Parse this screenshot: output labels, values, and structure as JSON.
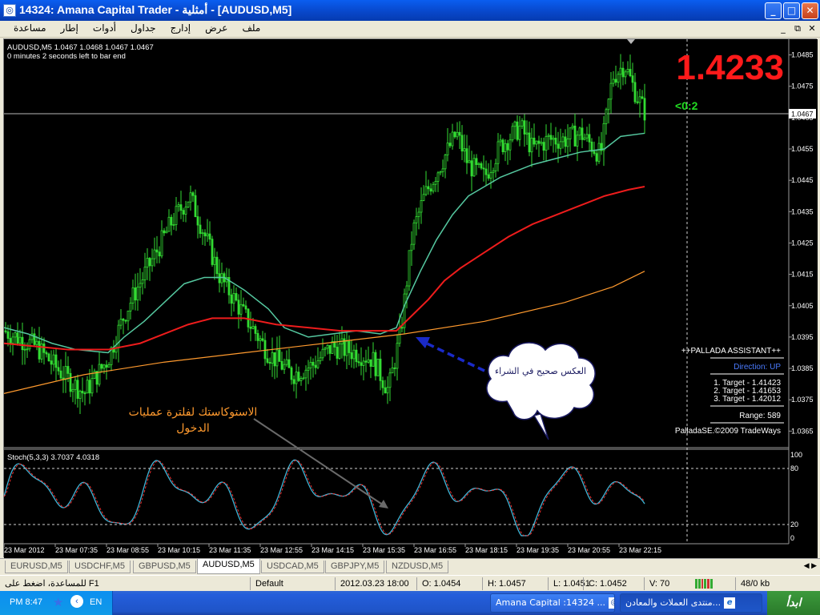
{
  "window": {
    "title": "14324: Amana Capital Trader - أمثلية - [AUDUSD,M5]",
    "app_icon": "amana-logo-icon",
    "buttons": {
      "minimize": "_",
      "maximize": "□",
      "close": "✕"
    }
  },
  "menu": {
    "items": [
      "ملف",
      "عرض",
      "إدارج",
      "جداول",
      "أدوات",
      "إطار",
      "مساعدة"
    ],
    "mdi_buttons": {
      "minimize": "_",
      "restore": "⧉",
      "close": "✕"
    }
  },
  "chart": {
    "symbol_header": "AUDUSD,M5  1.0467 1.0468 1.0467 1.0467",
    "bar_timer": "0 minutes 2 seconds left to bar end",
    "big_price": "1.4233",
    "spread_label": "<0:2",
    "current_price_tag": "1.0467",
    "price_axis": [
      "1.0485",
      "1.0475",
      "1.0465",
      "1.0455",
      "1.0445",
      "1.0435",
      "1.0425",
      "1.0415",
      "1.0405",
      "1.0395",
      "1.0385",
      "1.0375",
      "1.0365"
    ],
    "annotations": {
      "stochastic_note_line1": "الاستوكاستك لفلترة عمليات",
      "stochastic_note_line2": "الدخول",
      "cloud_text": "العكس صحيح في الشراء"
    },
    "panel": {
      "title": "++PALLADA ASSISTANT++",
      "direction": "Direction: UP",
      "target1": "1. Target - 1.41423",
      "target2": "2. Target - 1.41653",
      "target3": "3. Target - 1.42012",
      "range": "Range: 589",
      "copyright": "PalladaSE.©2009 TradeWays"
    },
    "stoch": {
      "label": "Stoch(5,3,3) 3.7037 4.0318",
      "levels": [
        "100",
        "80",
        "20",
        "0"
      ]
    },
    "time_axis": [
      "23 Mar 2012",
      "23 Mar 07:35",
      "23 Mar 08:55",
      "23 Mar 10:15",
      "23 Mar 11:35",
      "23 Mar 12:55",
      "23 Mar 14:15",
      "23 Mar 15:35",
      "23 Mar 16:55",
      "23 Mar 18:15",
      "23 Mar 19:35",
      "23 Mar 20:55",
      "23 Mar 22:15"
    ],
    "colors": {
      "candles": "#33dd33",
      "fast_ma": "#55c8a0",
      "slow_ma": "#ee1c1c",
      "long_ma": "#ff9a2e",
      "stoch_main": "#3fb6d8",
      "stoch_signal": "#ee3030",
      "big_price": "#ff1a1a",
      "spread": "#22dd22"
    }
  },
  "tabs": {
    "items": [
      "EURUSD,M5",
      "USDCHF,M5",
      "GBPUSD,M5",
      "AUDUSD,M5",
      "USDCAD,M5",
      "GBPJPY,M5",
      "NZDUSD,M5"
    ],
    "active": "AUDUSD,M5"
  },
  "status": {
    "help": "للمساعدة، اضغط على F1",
    "profile": "Default",
    "datetime": "2012.03.23 18:00",
    "open": "O: 1.0454",
    "high": "H: 1.0457",
    "low": "L: 1.0451",
    "close": "C: 1.0452",
    "volume": "V: 70",
    "traffic": "48/0 kb"
  },
  "taskbar": {
    "clock": "PM 8:47",
    "language": "EN",
    "task1": "Amana Capital :14324 ...",
    "task2": "منتدى العملات والمعادن...",
    "start": "ابدأ"
  }
}
